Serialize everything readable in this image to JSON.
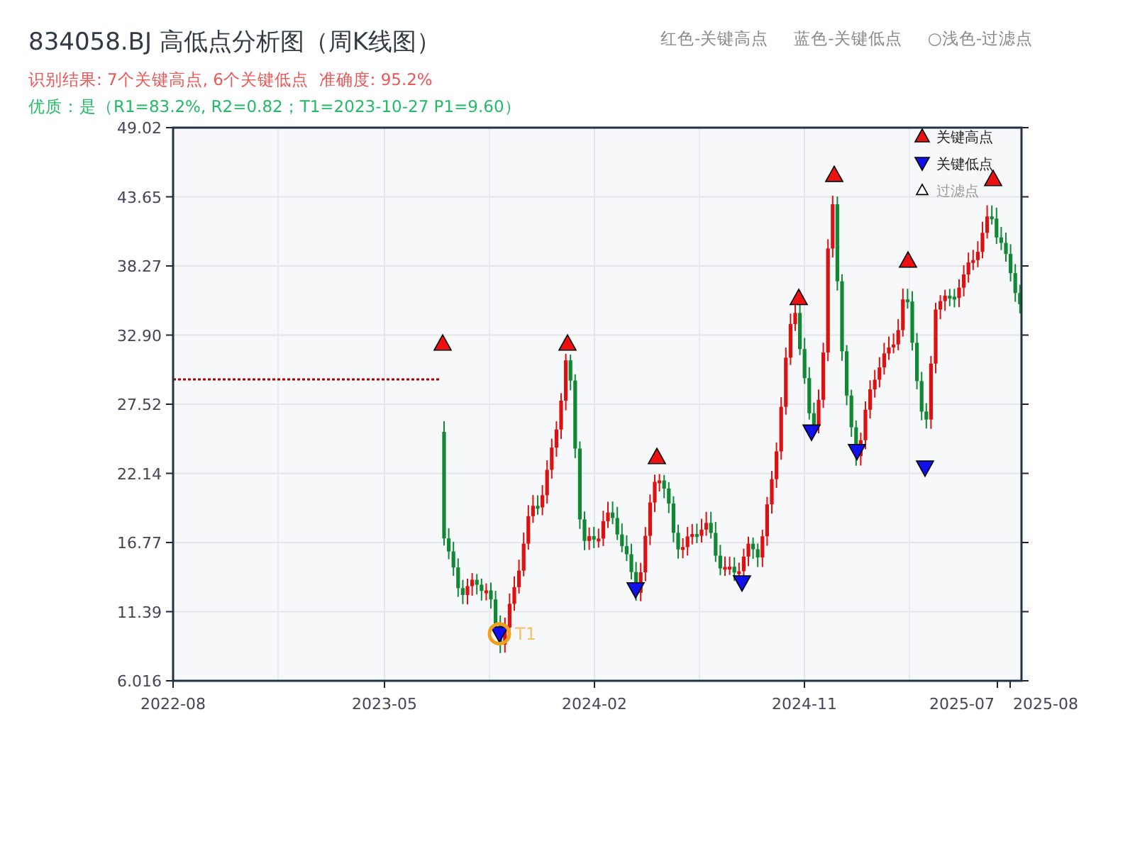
{
  "title": "834058.BJ 高低点分析图（周K线图）",
  "result_line": "识别结果: 7个关键高点, 6个关键低点  准确度: 95.2%",
  "quality_line": "优质：是（R1=83.2%, R2=0.82；T1=2023-10-27 P1=9.60）",
  "color_legend": [
    "红色-关键高点",
    "蓝色-关键低点",
    "○浅色-过滤点"
  ],
  "chart": {
    "y_ticks": [
      "49.02",
      "43.65",
      "38.27",
      "32.90",
      "27.52",
      "22.14",
      "16.77",
      "11.39",
      "6.016"
    ],
    "x_ticks": [
      "2022-08",
      "2023-05",
      "2024-02",
      "2024-11",
      "2025-07",
      "2025-08"
    ],
    "marker_label": "T1",
    "legend": [
      {
        "kind": "high",
        "label": "关键高点"
      },
      {
        "kind": "low",
        "label": "关键低点"
      },
      {
        "kind": "filtered",
        "label": "过滤点"
      }
    ]
  }
}
